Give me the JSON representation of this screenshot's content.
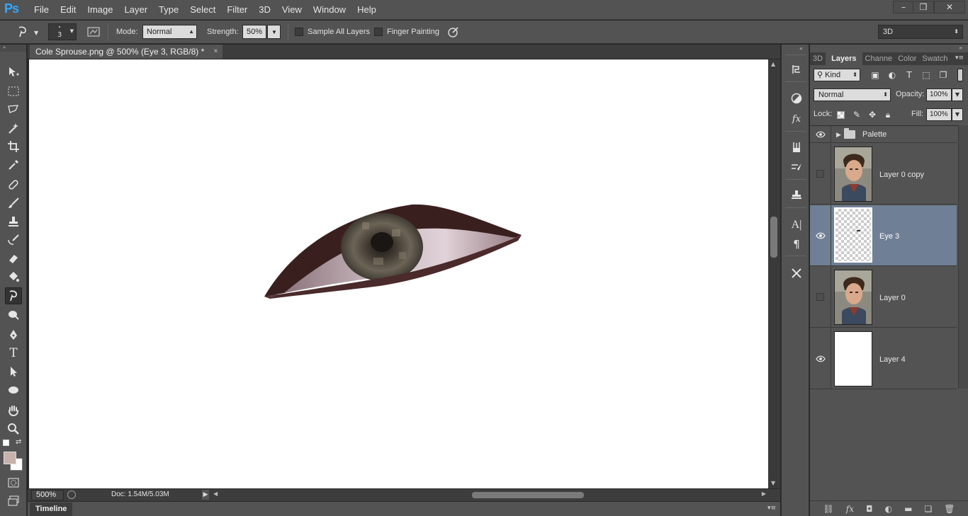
{
  "app": {
    "logo": "Ps"
  },
  "menu": [
    "File",
    "Edit",
    "Image",
    "Layer",
    "Type",
    "Select",
    "Filter",
    "3D",
    "View",
    "Window",
    "Help"
  ],
  "window_controls": {
    "minimize": "–",
    "restore": "❒",
    "close": "✕"
  },
  "options": {
    "brush_size": "3",
    "mode_label": "Mode:",
    "mode_value": "Normal",
    "strength_label": "Strength:",
    "strength_value": "50%",
    "sample_all_layers": "Sample All Layers",
    "finger_painting": "Finger Painting",
    "workspace": "3D"
  },
  "document": {
    "tab_title": "Cole Sprouse.png @ 500% (Eye 3, RGB/8) *",
    "close": "×",
    "zoom": "500%",
    "doc_size": "Doc: 1.54M/5.03M"
  },
  "timeline": {
    "label": "Timeline"
  },
  "colors": {
    "foreground": "#c7b1aa",
    "background": "#ffffff",
    "selected_layer": "#6f7f95"
  },
  "layers_panel": {
    "tabs": [
      "3D",
      "Layers",
      "Channe",
      "Color",
      "Swatch"
    ],
    "active_tab": "Layers",
    "filter_kind": "Kind",
    "blend_mode": "Normal",
    "opacity_label": "Opacity:",
    "opacity_value": "100%",
    "lock_label": "Lock:",
    "fill_label": "Fill:",
    "fill_value": "100%",
    "layers": [
      {
        "name": "Palette",
        "type": "group",
        "visible": true
      },
      {
        "name": "Layer 0 copy",
        "type": "photo",
        "visible": false
      },
      {
        "name": "Eye 3",
        "type": "transparent",
        "visible": true,
        "selected": true
      },
      {
        "name": "Layer 0",
        "type": "photo",
        "visible": false
      },
      {
        "name": "Layer 4",
        "type": "white",
        "visible": true
      }
    ]
  }
}
